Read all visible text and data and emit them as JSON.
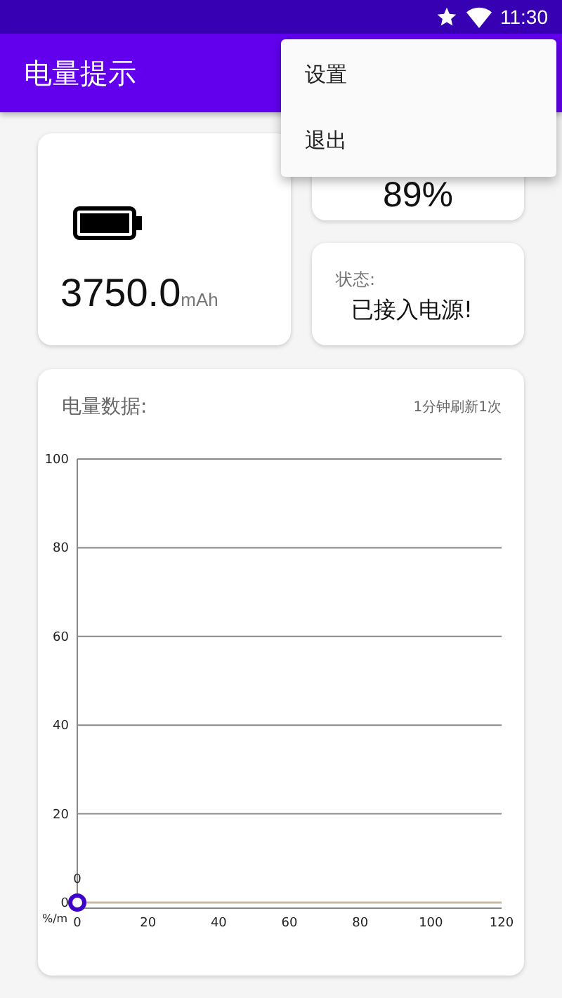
{
  "status_bar": {
    "time": "11:30"
  },
  "app_bar": {
    "title": "电量提示"
  },
  "capacity_card": {
    "value": "3750.0",
    "unit": "mAh"
  },
  "level_card": {
    "value": "89%"
  },
  "status_card": {
    "label": "状态:",
    "value": "已接入电源!"
  },
  "chart_card": {
    "title": "电量数据:",
    "refresh_note": "1分钟刷新1次",
    "chart_data": {
      "type": "line",
      "ylabel": "%/m",
      "x": [
        0
      ],
      "series": [
        {
          "color": "#3f00c8",
          "marker": true,
          "values": [
            0
          ]
        }
      ],
      "grid": true,
      "xlim": [
        0,
        120
      ],
      "ylim": [
        0,
        100
      ],
      "xticks": [
        0,
        20,
        40,
        60,
        80,
        100,
        120
      ],
      "yticks": [
        0,
        20,
        40,
        60,
        80,
        100
      ],
      "data_labels": true
    }
  },
  "menu": {
    "items": [
      {
        "label": "设置"
      },
      {
        "label": "退出"
      }
    ]
  }
}
